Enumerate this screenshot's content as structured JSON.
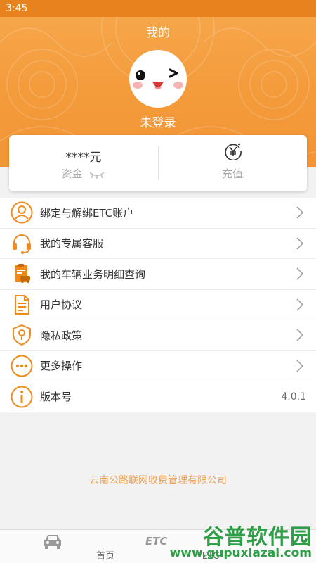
{
  "status_bar": {
    "time": "3:45"
  },
  "header": {
    "title": "我的",
    "login_status": "未登录"
  },
  "account_card": {
    "balance_value": "****元",
    "balance_label": "资金",
    "recharge_label": "充值"
  },
  "menu": {
    "items": [
      {
        "label": "绑定与解绑ETC账户",
        "icon": "user-icon"
      },
      {
        "label": "我的专属客服",
        "icon": "headset-icon"
      },
      {
        "label": "我的车辆业务明细查询",
        "icon": "clipboard-car-icon"
      },
      {
        "label": "用户协议",
        "icon": "document-icon"
      },
      {
        "label": "隐私政策",
        "icon": "shield-lock-icon"
      },
      {
        "label": "更多操作",
        "icon": "more-icon"
      },
      {
        "label": "版本号",
        "icon": "info-icon",
        "value": "4.0.1"
      }
    ]
  },
  "footer": {
    "company": "云南公路联网收费管理有限公司"
  },
  "tabbar": {
    "tabs": [
      {
        "label": "首页",
        "icon": "car-icon"
      },
      {
        "label": "ETC",
        "icon": "etc-icon"
      },
      {
        "label": "",
        "icon": ""
      }
    ]
  },
  "watermark": {
    "text": "谷普软件园",
    "url": "www.gupuxlazal.com"
  },
  "colors": {
    "accent": "#f29536",
    "icon": "#f08a1c"
  }
}
